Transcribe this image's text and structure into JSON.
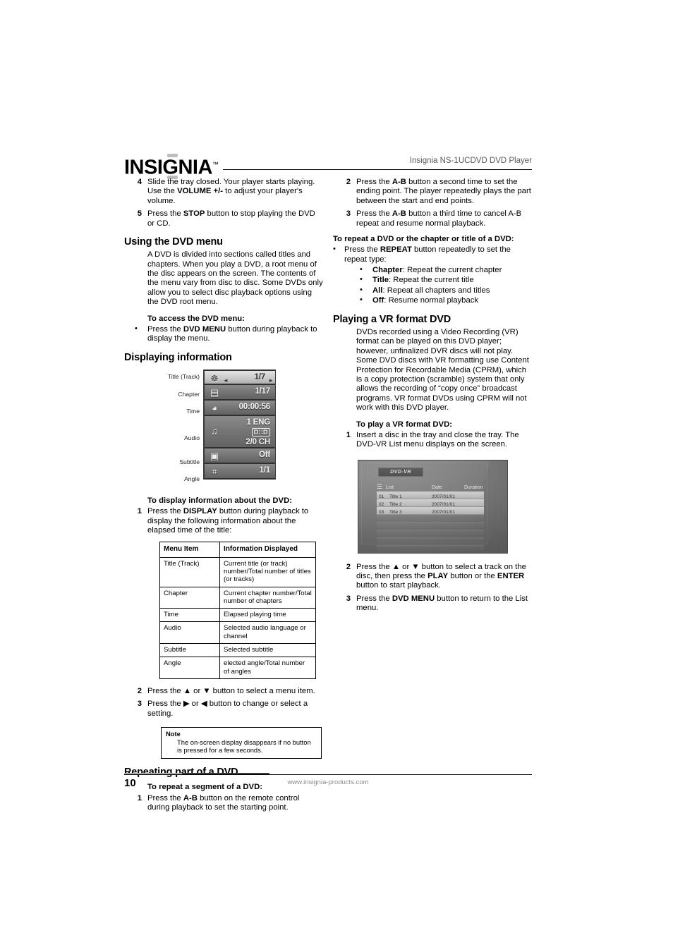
{
  "header": {
    "logo_text": "INSIGNIA",
    "logo_tm": "™",
    "title": "Insignia NS-1UCDVD DVD Player"
  },
  "footer": {
    "page_number": "10",
    "url": "www.insignia-products.com"
  },
  "left_column": {
    "continued_steps": [
      {
        "num": "4",
        "html": "Slide the tray closed. Your player starts playing. Use the <b>VOLUME +/-</b> to adjust your player's volume."
      },
      {
        "num": "5",
        "html": "Press the <b>STOP</b> button to stop playing the DVD or CD."
      }
    ],
    "section_dvd_menu": {
      "heading": "Using the DVD menu",
      "paragraph": "A DVD is divided into sections called titles and chapters. When you play a DVD, a root menu of the disc appears on the screen. The contents of the menu vary from disc to disc. Some DVDs only allow you to select disc playback options using the DVD root menu.",
      "sub_heading": "To access the DVD menu:",
      "bullets": [
        {
          "html": "Press the <b>DVD MENU</b> button during playback to display the menu."
        }
      ]
    },
    "section_display_info": {
      "heading": "Displaying information",
      "osd": {
        "rows": [
          {
            "label": "Title (Track)",
            "icon": "film-reel-icon",
            "glyph": "☸",
            "value": "1/7",
            "arrows": true
          },
          {
            "label": "Chapter",
            "icon": "chapter-icon",
            "glyph": "▤",
            "value": "1/17",
            "arrows": false
          },
          {
            "label": "Time",
            "icon": "clock-disc-icon",
            "glyph": "◕",
            "value": "00:00:56",
            "arrows": false
          },
          {
            "label": "Audio",
            "icon": "headphones-icon",
            "glyph": "♫",
            "value": "1 ENG",
            "value2": "D∷D",
            "value3": "2/0  CH",
            "arrows": false
          },
          {
            "label": "Subtitle",
            "icon": "subtitle-screen-icon",
            "glyph": "▣",
            "value": "Off",
            "arrows": false
          },
          {
            "label": "Angle",
            "icon": "movie-camera-icon",
            "glyph": "⌗",
            "value": "1/1",
            "arrows": false
          }
        ],
        "arrow_left": "◄",
        "arrow_right": "►"
      },
      "sub_heading": "To display information about the DVD:",
      "step1": {
        "num": "1",
        "html": "Press the <b>DISPLAY</b> button during playback to display the following information about the elapsed time of the title:"
      },
      "table": {
        "columns": [
          "Menu Item",
          "Information Displayed"
        ],
        "rows": [
          [
            "Title (Track)",
            "Current title (or track) number/Total number of titles (or tracks)"
          ],
          [
            "Chapter",
            "Current chapter number/Total number of chapters"
          ],
          [
            "Time",
            "Elapsed playing time"
          ],
          [
            "Audio",
            "Selected audio language or channel"
          ],
          [
            "Subtitle",
            "Selected subtitle"
          ],
          [
            "Angle",
            "elected angle/Total number of angles"
          ]
        ]
      },
      "steps_after_table": [
        {
          "num": "2",
          "html": "Press the ▲ or ▼ button to select a menu item."
        },
        {
          "num": "3",
          "html": "Press the ▶ or ◀ button to change or select a setting."
        }
      ],
      "note": {
        "title": "Note",
        "body": "The on-screen display disappears if no button is pressed for a few seconds."
      }
    },
    "section_repeating": {
      "heading": "Repeating part of a DVD",
      "sub_heading": "To repeat a segment of a DVD:",
      "steps": [
        {
          "num": "1",
          "html": "Press the <b>A-B</b> button on the remote control during playback to set the starting point."
        }
      ]
    }
  },
  "right_column": {
    "continued_steps": [
      {
        "num": "2",
        "html": "Press the <b>A-B</b> button a second time to set the ending point. The player repeatedly plays the part between the start and end points."
      },
      {
        "num": "3",
        "html": "Press the <b>A-B</b> button a third time to cancel A-B repeat and resume normal playback."
      }
    ],
    "repeat_section": {
      "sub_heading": "To repeat a DVD or the chapter or title of a DVD:",
      "bullets": [
        {
          "html": "Press the <b>REPEAT</b> button repeatedly to set the repeat type:"
        }
      ],
      "sub_bullets": [
        {
          "html": "<b>Chapter</b>: Repeat the current chapter"
        },
        {
          "html": "<b>Title</b>: Repeat the current title"
        },
        {
          "html": "<b>All</b>: Repeat all chapters and titles"
        },
        {
          "html": "<b>Off</b>: Resume normal playback"
        }
      ]
    },
    "section_vr": {
      "heading": "Playing a VR format DVD",
      "paragraph": "DVDs recorded using a Video Recording (VR) format can be played on this DVD player; however, unfinalized DVR discs will not play. Some DVD discs with VR formatting use Content Protection for Recordable Media (CPRM), which is a copy protection (scramble) system that only allows the recording of “copy once” broadcast programs. VR format DVDs using CPRM will not work with this DVD player.",
      "sub_heading": "To play a VR format DVD:",
      "step1": {
        "num": "1",
        "html": "Insert a disc in the tray and close the tray. The DVD-VR List menu displays on the screen."
      },
      "vr_screen": {
        "tab_label": "DVD-VR",
        "list_icon": "list-icon",
        "columns": [
          "List",
          "Date",
          "Duration"
        ],
        "rows": [
          {
            "no": "01",
            "title": "Title 1",
            "date": "2007/01/01",
            "duration": ""
          },
          {
            "no": "02",
            "title": "Title 2",
            "date": "2007/01/01",
            "duration": ""
          },
          {
            "no": "03",
            "title": "Title 3",
            "date": "2007/01/01",
            "duration": ""
          }
        ],
        "empty_row_count": 5
      },
      "steps_after": [
        {
          "num": "2",
          "html": "Press the ▲ or ▼ button to select a track on the disc, then press the <b>PLAY</b> button or the <b>ENTER</b> button to start playback."
        },
        {
          "num": "3",
          "html": "Press the <b>DVD MENU</b> button to return to the List menu."
        }
      ]
    }
  }
}
